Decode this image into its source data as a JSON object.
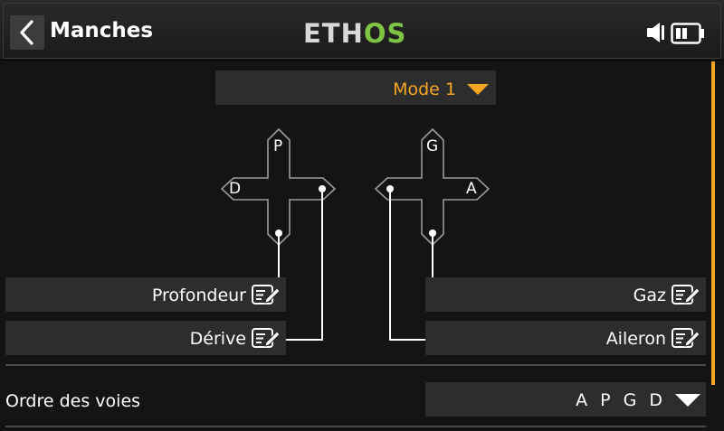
{
  "header": {
    "back_icon": "chevron-left-icon",
    "title": "Manches",
    "logo_part1": "ETH",
    "logo_part2": "OS",
    "logo_colors": {
      "primary": "#d8d8d8",
      "accent": "#7fc343"
    },
    "status_icons": [
      "speaker-icon",
      "battery-icon"
    ]
  },
  "mode_selector": {
    "value": "Mode 1",
    "color": "#f5a623"
  },
  "sticks": {
    "left": {
      "top": "P",
      "left": "D"
    },
    "right": {
      "top": "G",
      "right": "A"
    }
  },
  "assignments": {
    "left": [
      {
        "label": "Profondeur"
      },
      {
        "label": "Dérive"
      }
    ],
    "right": [
      {
        "label": "Gaz"
      },
      {
        "label": "Aileron"
      }
    ]
  },
  "channel_order": {
    "label": "Ordre des voies",
    "value": "A P G D"
  },
  "colors": {
    "accent": "#f5a623",
    "background": "#141414",
    "field": "#2d2d2d"
  }
}
